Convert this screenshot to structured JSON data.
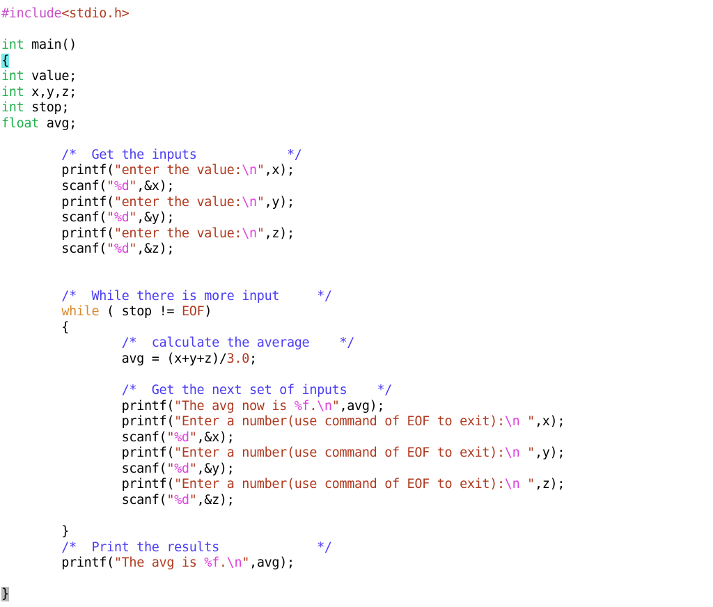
{
  "editor": {
    "language": "c",
    "background": "#ffffff",
    "colors": {
      "preprocessor": "#c850c8",
      "header": "#b03a20",
      "type": "#22b14c",
      "keyword": "#d98a2b",
      "comment": "#4b3df5",
      "string": "#b03a20",
      "format_escape": "#e040e0",
      "plain": "#000000",
      "brace_match_open_highlight": "#76e8e8",
      "brace_match_close_highlight": "#b8b8b8"
    }
  },
  "code": {
    "lines": [
      {
        "tokens": [
          {
            "t": "#include",
            "c": "pp"
          },
          {
            "t": "<stdio.h>",
            "c": "hdr"
          }
        ]
      },
      {
        "tokens": []
      },
      {
        "tokens": [
          {
            "t": "int",
            "c": "type"
          },
          {
            "t": " main()",
            "c": "plain"
          }
        ]
      },
      {
        "tokens": [
          {
            "t": "{",
            "c": "brace-open"
          }
        ]
      },
      {
        "tokens": [
          {
            "t": "int",
            "c": "type"
          },
          {
            "t": " value;",
            "c": "plain"
          }
        ]
      },
      {
        "tokens": [
          {
            "t": "int",
            "c": "type"
          },
          {
            "t": " x,y,z;",
            "c": "plain"
          }
        ]
      },
      {
        "tokens": [
          {
            "t": "int",
            "c": "type"
          },
          {
            "t": " stop;",
            "c": "plain"
          }
        ]
      },
      {
        "tokens": [
          {
            "t": "float",
            "c": "type"
          },
          {
            "t": " avg;",
            "c": "plain"
          }
        ]
      },
      {
        "tokens": []
      },
      {
        "tokens": [
          {
            "t": "        /*  Get the inputs            */",
            "c": "com"
          }
        ]
      },
      {
        "tokens": [
          {
            "t": "        printf(",
            "c": "plain"
          },
          {
            "t": "\"enter the value:",
            "c": "str"
          },
          {
            "t": "\\n",
            "c": "fmt"
          },
          {
            "t": "\"",
            "c": "str"
          },
          {
            "t": ",x);",
            "c": "plain"
          }
        ]
      },
      {
        "tokens": [
          {
            "t": "        scanf(",
            "c": "plain"
          },
          {
            "t": "\"",
            "c": "str"
          },
          {
            "t": "%d",
            "c": "fmt"
          },
          {
            "t": "\"",
            "c": "str"
          },
          {
            "t": ",&x);",
            "c": "plain"
          }
        ]
      },
      {
        "tokens": [
          {
            "t": "        printf(",
            "c": "plain"
          },
          {
            "t": "\"enter the value:",
            "c": "str"
          },
          {
            "t": "\\n",
            "c": "fmt"
          },
          {
            "t": "\"",
            "c": "str"
          },
          {
            "t": ",y);",
            "c": "plain"
          }
        ]
      },
      {
        "tokens": [
          {
            "t": "        scanf(",
            "c": "plain"
          },
          {
            "t": "\"",
            "c": "str"
          },
          {
            "t": "%d",
            "c": "fmt"
          },
          {
            "t": "\"",
            "c": "str"
          },
          {
            "t": ",&y);",
            "c": "plain"
          }
        ]
      },
      {
        "tokens": [
          {
            "t": "        printf(",
            "c": "plain"
          },
          {
            "t": "\"enter the value:",
            "c": "str"
          },
          {
            "t": "\\n",
            "c": "fmt"
          },
          {
            "t": "\"",
            "c": "str"
          },
          {
            "t": ",z);",
            "c": "plain"
          }
        ]
      },
      {
        "tokens": [
          {
            "t": "        scanf(",
            "c": "plain"
          },
          {
            "t": "\"",
            "c": "str"
          },
          {
            "t": "%d",
            "c": "fmt"
          },
          {
            "t": "\"",
            "c": "str"
          },
          {
            "t": ",&z);",
            "c": "plain"
          }
        ]
      },
      {
        "tokens": []
      },
      {
        "tokens": []
      },
      {
        "tokens": [
          {
            "t": "        /*  While there is more input     */",
            "c": "com"
          }
        ]
      },
      {
        "tokens": [
          {
            "t": "        ",
            "c": "plain"
          },
          {
            "t": "while",
            "c": "kw"
          },
          {
            "t": " ( stop != ",
            "c": "plain"
          },
          {
            "t": "EOF",
            "c": "str"
          },
          {
            "t": ")",
            "c": "plain"
          }
        ]
      },
      {
        "tokens": [
          {
            "t": "        {",
            "c": "plain"
          }
        ]
      },
      {
        "tokens": [
          {
            "t": "                /*  calculate the average    */",
            "c": "com"
          }
        ]
      },
      {
        "tokens": [
          {
            "t": "                avg = (x+y+z)/",
            "c": "plain"
          },
          {
            "t": "3.0",
            "c": "str"
          },
          {
            "t": ";",
            "c": "plain"
          }
        ]
      },
      {
        "tokens": []
      },
      {
        "tokens": [
          {
            "t": "                /*  Get the next set of inputs    */",
            "c": "com"
          }
        ]
      },
      {
        "tokens": [
          {
            "t": "                printf(",
            "c": "plain"
          },
          {
            "t": "\"The avg now is ",
            "c": "str"
          },
          {
            "t": "%f",
            "c": "fmt"
          },
          {
            "t": ".",
            "c": "str"
          },
          {
            "t": "\\n",
            "c": "fmt"
          },
          {
            "t": "\"",
            "c": "str"
          },
          {
            "t": ",avg);",
            "c": "plain"
          }
        ]
      },
      {
        "tokens": [
          {
            "t": "                printf(",
            "c": "plain"
          },
          {
            "t": "\"Enter a number(use command of EOF to exit):",
            "c": "str"
          },
          {
            "t": "\\n",
            "c": "fmt"
          },
          {
            "t": " \"",
            "c": "str"
          },
          {
            "t": ",x);",
            "c": "plain"
          }
        ]
      },
      {
        "tokens": [
          {
            "t": "                scanf(",
            "c": "plain"
          },
          {
            "t": "\"",
            "c": "str"
          },
          {
            "t": "%d",
            "c": "fmt"
          },
          {
            "t": "\"",
            "c": "str"
          },
          {
            "t": ",&x);",
            "c": "plain"
          }
        ]
      },
      {
        "tokens": [
          {
            "t": "                printf(",
            "c": "plain"
          },
          {
            "t": "\"Enter a number(use command of EOF to exit):",
            "c": "str"
          },
          {
            "t": "\\n",
            "c": "fmt"
          },
          {
            "t": " \"",
            "c": "str"
          },
          {
            "t": ",y);",
            "c": "plain"
          }
        ]
      },
      {
        "tokens": [
          {
            "t": "                scanf(",
            "c": "plain"
          },
          {
            "t": "\"",
            "c": "str"
          },
          {
            "t": "%d",
            "c": "fmt"
          },
          {
            "t": "\"",
            "c": "str"
          },
          {
            "t": ",&y);",
            "c": "plain"
          }
        ]
      },
      {
        "tokens": [
          {
            "t": "                printf(",
            "c": "plain"
          },
          {
            "t": "\"Enter a number(use command of EOF to exit):",
            "c": "str"
          },
          {
            "t": "\\n",
            "c": "fmt"
          },
          {
            "t": " \"",
            "c": "str"
          },
          {
            "t": ",z);",
            "c": "plain"
          }
        ]
      },
      {
        "tokens": [
          {
            "t": "                scanf(",
            "c": "plain"
          },
          {
            "t": "\"",
            "c": "str"
          },
          {
            "t": "%d",
            "c": "fmt"
          },
          {
            "t": "\"",
            "c": "str"
          },
          {
            "t": ",&z);",
            "c": "plain"
          }
        ]
      },
      {
        "tokens": []
      },
      {
        "tokens": [
          {
            "t": "        }",
            "c": "plain"
          }
        ]
      },
      {
        "tokens": [
          {
            "t": "        /*  Print the results             */",
            "c": "com"
          }
        ]
      },
      {
        "tokens": [
          {
            "t": "        printf(",
            "c": "plain"
          },
          {
            "t": "\"The avg is ",
            "c": "str"
          },
          {
            "t": "%f",
            "c": "fmt"
          },
          {
            "t": ".",
            "c": "str"
          },
          {
            "t": "\\n",
            "c": "fmt"
          },
          {
            "t": "\"",
            "c": "str"
          },
          {
            "t": ",avg);",
            "c": "plain"
          }
        ]
      },
      {
        "tokens": []
      },
      {
        "tokens": [
          {
            "t": "}",
            "c": "brace-close"
          }
        ]
      }
    ]
  }
}
